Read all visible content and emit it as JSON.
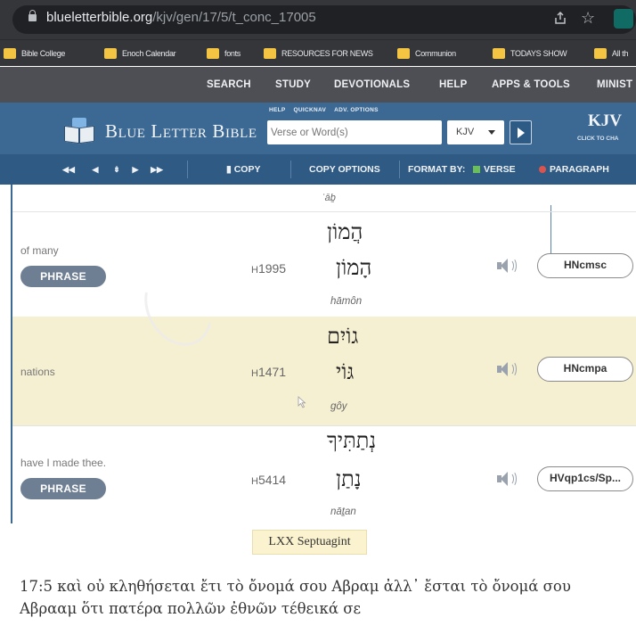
{
  "browser": {
    "url_domain": "blueletterbible.org",
    "url_path": "/kjv/gen/17/5/t_conc_17005",
    "icons": [
      "lock-icon",
      "share-icon",
      "star-icon",
      "extension-icon"
    ]
  },
  "bookmarks": [
    {
      "label": "Bible College"
    },
    {
      "label": "Enoch Calendar"
    },
    {
      "label": "fonts"
    },
    {
      "label": "RESOURCES FOR NEWS"
    },
    {
      "label": "Communion"
    },
    {
      "label": "TODAYS SHOW"
    },
    {
      "label": "All th"
    }
  ],
  "site_nav": [
    "SEARCH",
    "STUDY",
    "DEVOTIONALS",
    "HELP",
    "APPS & TOOLS",
    "MINIST"
  ],
  "header": {
    "brand": "Blue Letter Bible",
    "options": [
      "HELP",
      "QUICKNAV",
      "ADV. OPTIONS"
    ],
    "search_placeholder": "Verse or Word(s)",
    "version_value": "KJV",
    "kjv_title": "KJV",
    "kjv_subtitle": "CLICK TO CHA"
  },
  "toolbar": {
    "copy_label": "COPY",
    "copy_options_label": "COPY OPTIONS",
    "format_by_label": "FORMAT BY:",
    "verse_label": "VERSE",
    "paragraph_label": "PARAGRAPH"
  },
  "top_translit": "ʾāḇ",
  "rows": [
    {
      "english": "of many",
      "phrase": "PHRASE",
      "strongs_prefix": "H",
      "strongs_num": "1995",
      "hebrew_pointed": "הֲמוֹן",
      "hebrew_lemma": "הָמוֹן",
      "translit": "hāmôn",
      "morph": "HNcmsc"
    },
    {
      "english": "nations",
      "phrase": "",
      "strongs_prefix": "H",
      "strongs_num": "1471",
      "hebrew_pointed": "גוֹיִם",
      "hebrew_lemma": "גּוֹי",
      "translit": "gôy",
      "morph": "HNcmpa"
    },
    {
      "english": "have I made thee.",
      "phrase": "PHRASE",
      "strongs_prefix": "H",
      "strongs_num": "5414",
      "hebrew_pointed": "נְתַתִּיךָ",
      "hebrew_lemma": "נָתַן",
      "translit": "nāṯan",
      "morph": "HVqp1cs/Sp..."
    }
  ],
  "lxx": {
    "label": "LXX Septuagint",
    "text": "17:5  καὶ οὐ κληθήσεται ἔτι τὸ ὄνομά σου Αβραμ ἀλλ᾽ ἔσται τὸ ὄνομά σου Αβρααμ ὅτι πατέρα πολλῶν ἐθνῶν τέθεικά σε"
  },
  "colors": {
    "nav_bar": "#4d4f55",
    "header_blue": "#3c6994",
    "toolbar_blue": "#2f5a83",
    "alt_row": "#f6f0d2",
    "phrase_button": "#6e7f93"
  }
}
